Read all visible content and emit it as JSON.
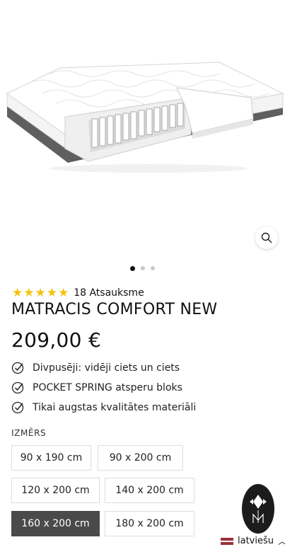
{
  "gallery": {
    "slides": 3,
    "active_slide": 1,
    "zoom_icon": "magnifier-icon"
  },
  "product": {
    "rating_stars": 5,
    "review_count_label": "18 Atsauksme",
    "title": "MATRACIS COMFORT NEW",
    "price": "209,00 €",
    "features": [
      "Divpusēji: vidēji ciets un ciets",
      "POCKET SPRING atsperu bloks",
      "Tikai augstas kvalitātes materiāli"
    ]
  },
  "size": {
    "label": "IZMĒRS",
    "options": [
      "90 x 190 cm",
      "90 x 200 cm",
      "120 x 200 cm",
      "140 x 200 cm",
      "160 x 200 cm",
      "180 x 200 cm"
    ],
    "selected": "160 x 200 cm"
  },
  "language": {
    "label": "latviešu"
  },
  "colors": {
    "star": "#f4c20d",
    "selected_option_bg": "#4a4a4a",
    "badge_bg": "#1c1c1c"
  }
}
